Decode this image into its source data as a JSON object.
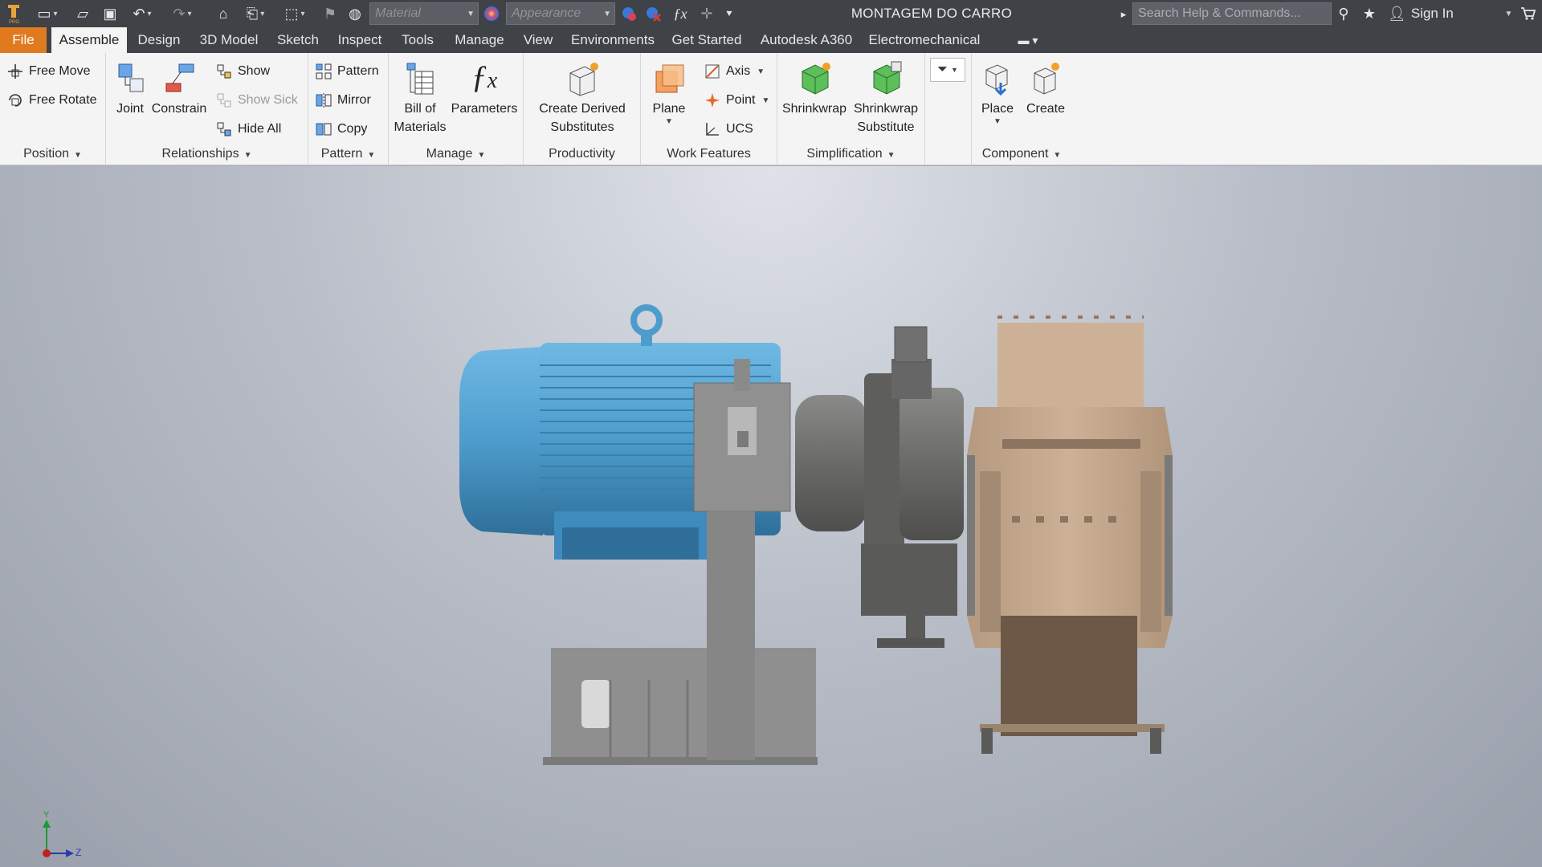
{
  "app": {
    "title": "MONTAGEM DO CARRO",
    "logo_icon": "inventor-logo-icon",
    "material_placeholder": "Material",
    "appearance_placeholder": "Appearance",
    "search_placeholder": "Search Help & Commands...",
    "sign_in": "Sign In"
  },
  "quick_access": [
    {
      "name": "new-icon",
      "glyph": "▭"
    },
    {
      "name": "open-icon",
      "glyph": "▱"
    },
    {
      "name": "save-icon",
      "glyph": "▣"
    },
    {
      "name": "undo-icon",
      "glyph": "↶"
    },
    {
      "name": "redo-icon",
      "glyph": "↷"
    },
    {
      "name": "home-icon",
      "glyph": "⌂"
    },
    {
      "name": "return-icon",
      "glyph": "⎗"
    },
    {
      "name": "select-icon",
      "glyph": "⬚"
    },
    {
      "name": "update-icon",
      "glyph": "⚑"
    },
    {
      "name": "globe-icon",
      "glyph": "◍"
    },
    {
      "name": "parameters-fx-icon",
      "glyph": "ƒx"
    },
    {
      "name": "measure-icon",
      "glyph": "✛"
    }
  ],
  "tabs": {
    "file": "File",
    "assemble": "Assemble",
    "design": "Design",
    "model3d": "3D Model",
    "sketch": "Sketch",
    "inspect": "Inspect",
    "tools": "Tools",
    "manage": "Manage",
    "view": "View",
    "environments": "Environments",
    "get_started": "Get Started",
    "a360": "Autodesk A360",
    "electromechanical": "Electromechanical"
  },
  "ribbon": {
    "position": {
      "label": "Position",
      "free_move": "Free Move",
      "free_rotate": "Free Rotate"
    },
    "relationships": {
      "label": "Relationships",
      "joint": "Joint",
      "constrain": "Constrain",
      "show": "Show",
      "show_sick": "Show Sick",
      "hide_all": "Hide All"
    },
    "pattern": {
      "label": "Pattern",
      "pattern": "Pattern",
      "mirror": "Mirror",
      "copy": "Copy"
    },
    "manage": {
      "label": "Manage",
      "bom_line1": "Bill of",
      "bom_line2": "Materials",
      "parameters": "Parameters"
    },
    "productivity": {
      "label": "Productivity",
      "derived_line1": "Create Derived",
      "derived_line2": "Substitutes"
    },
    "work_features": {
      "label": "Work Features",
      "plane": "Plane",
      "axis": "Axis",
      "point": "Point",
      "ucs": "UCS"
    },
    "simplification": {
      "label": "Simplification",
      "shrinkwrap": "Shrinkwrap",
      "shrinkwrap_sub_line1": "Shrinkwrap",
      "shrinkwrap_sub_line2": "Substitute"
    },
    "component": {
      "label": "Component",
      "place": "Place",
      "create": "Create"
    }
  },
  "viewport": {
    "triad": {
      "x_label": "Z",
      "y_label": "Y"
    }
  }
}
